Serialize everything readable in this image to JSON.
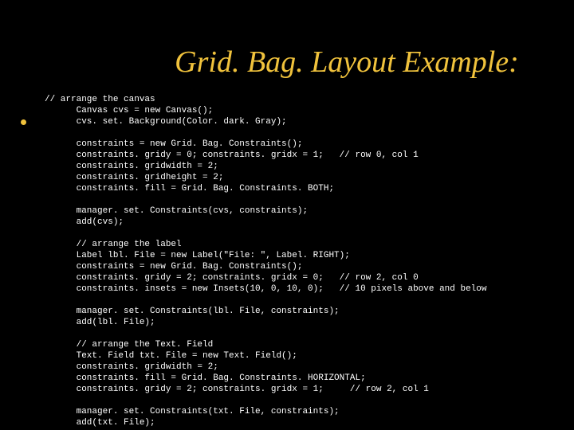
{
  "title": "Grid. Bag. Layout Example:",
  "code": {
    "l01": "// arrange the canvas",
    "l02": "      Canvas cvs = new Canvas();",
    "l03": "      cvs. set. Background(Color. dark. Gray);",
    "l04": "",
    "l05": "      constraints = new Grid. Bag. Constraints();",
    "l06": "      constraints. gridy = 0; constraints. gridx = 1;   // row 0, col 1",
    "l07": "      constraints. gridwidth = 2;",
    "l08": "      constraints. gridheight = 2;",
    "l09": "      constraints. fill = Grid. Bag. Constraints. BOTH;",
    "l10": "",
    "l11": "      manager. set. Constraints(cvs, constraints);",
    "l12": "      add(cvs);",
    "l13": "",
    "l14": "      // arrange the label",
    "l15": "      Label lbl. File = new Label(\"File: \", Label. RIGHT);",
    "l16": "      constraints = new Grid. Bag. Constraints();",
    "l17": "      constraints. gridy = 2; constraints. gridx = 0;   // row 2, col 0",
    "l18": "      constraints. insets = new Insets(10, 0, 10, 0);   // 10 pixels above and below",
    "l19": "",
    "l20": "      manager. set. Constraints(lbl. File, constraints);",
    "l21": "      add(lbl. File);",
    "l22": "",
    "l23": "      // arrange the Text. Field",
    "l24": "      Text. Field txt. File = new Text. Field();",
    "l25": "      constraints. gridwidth = 2;",
    "l26": "      constraints. fill = Grid. Bag. Constraints. HORIZONTAL;",
    "l27": "      constraints. gridy = 2; constraints. gridx = 1;     // row 2, col 1",
    "l28": "",
    "l29": "      manager. set. Constraints(txt. File, constraints);",
    "l30": "      add(txt. File);"
  }
}
